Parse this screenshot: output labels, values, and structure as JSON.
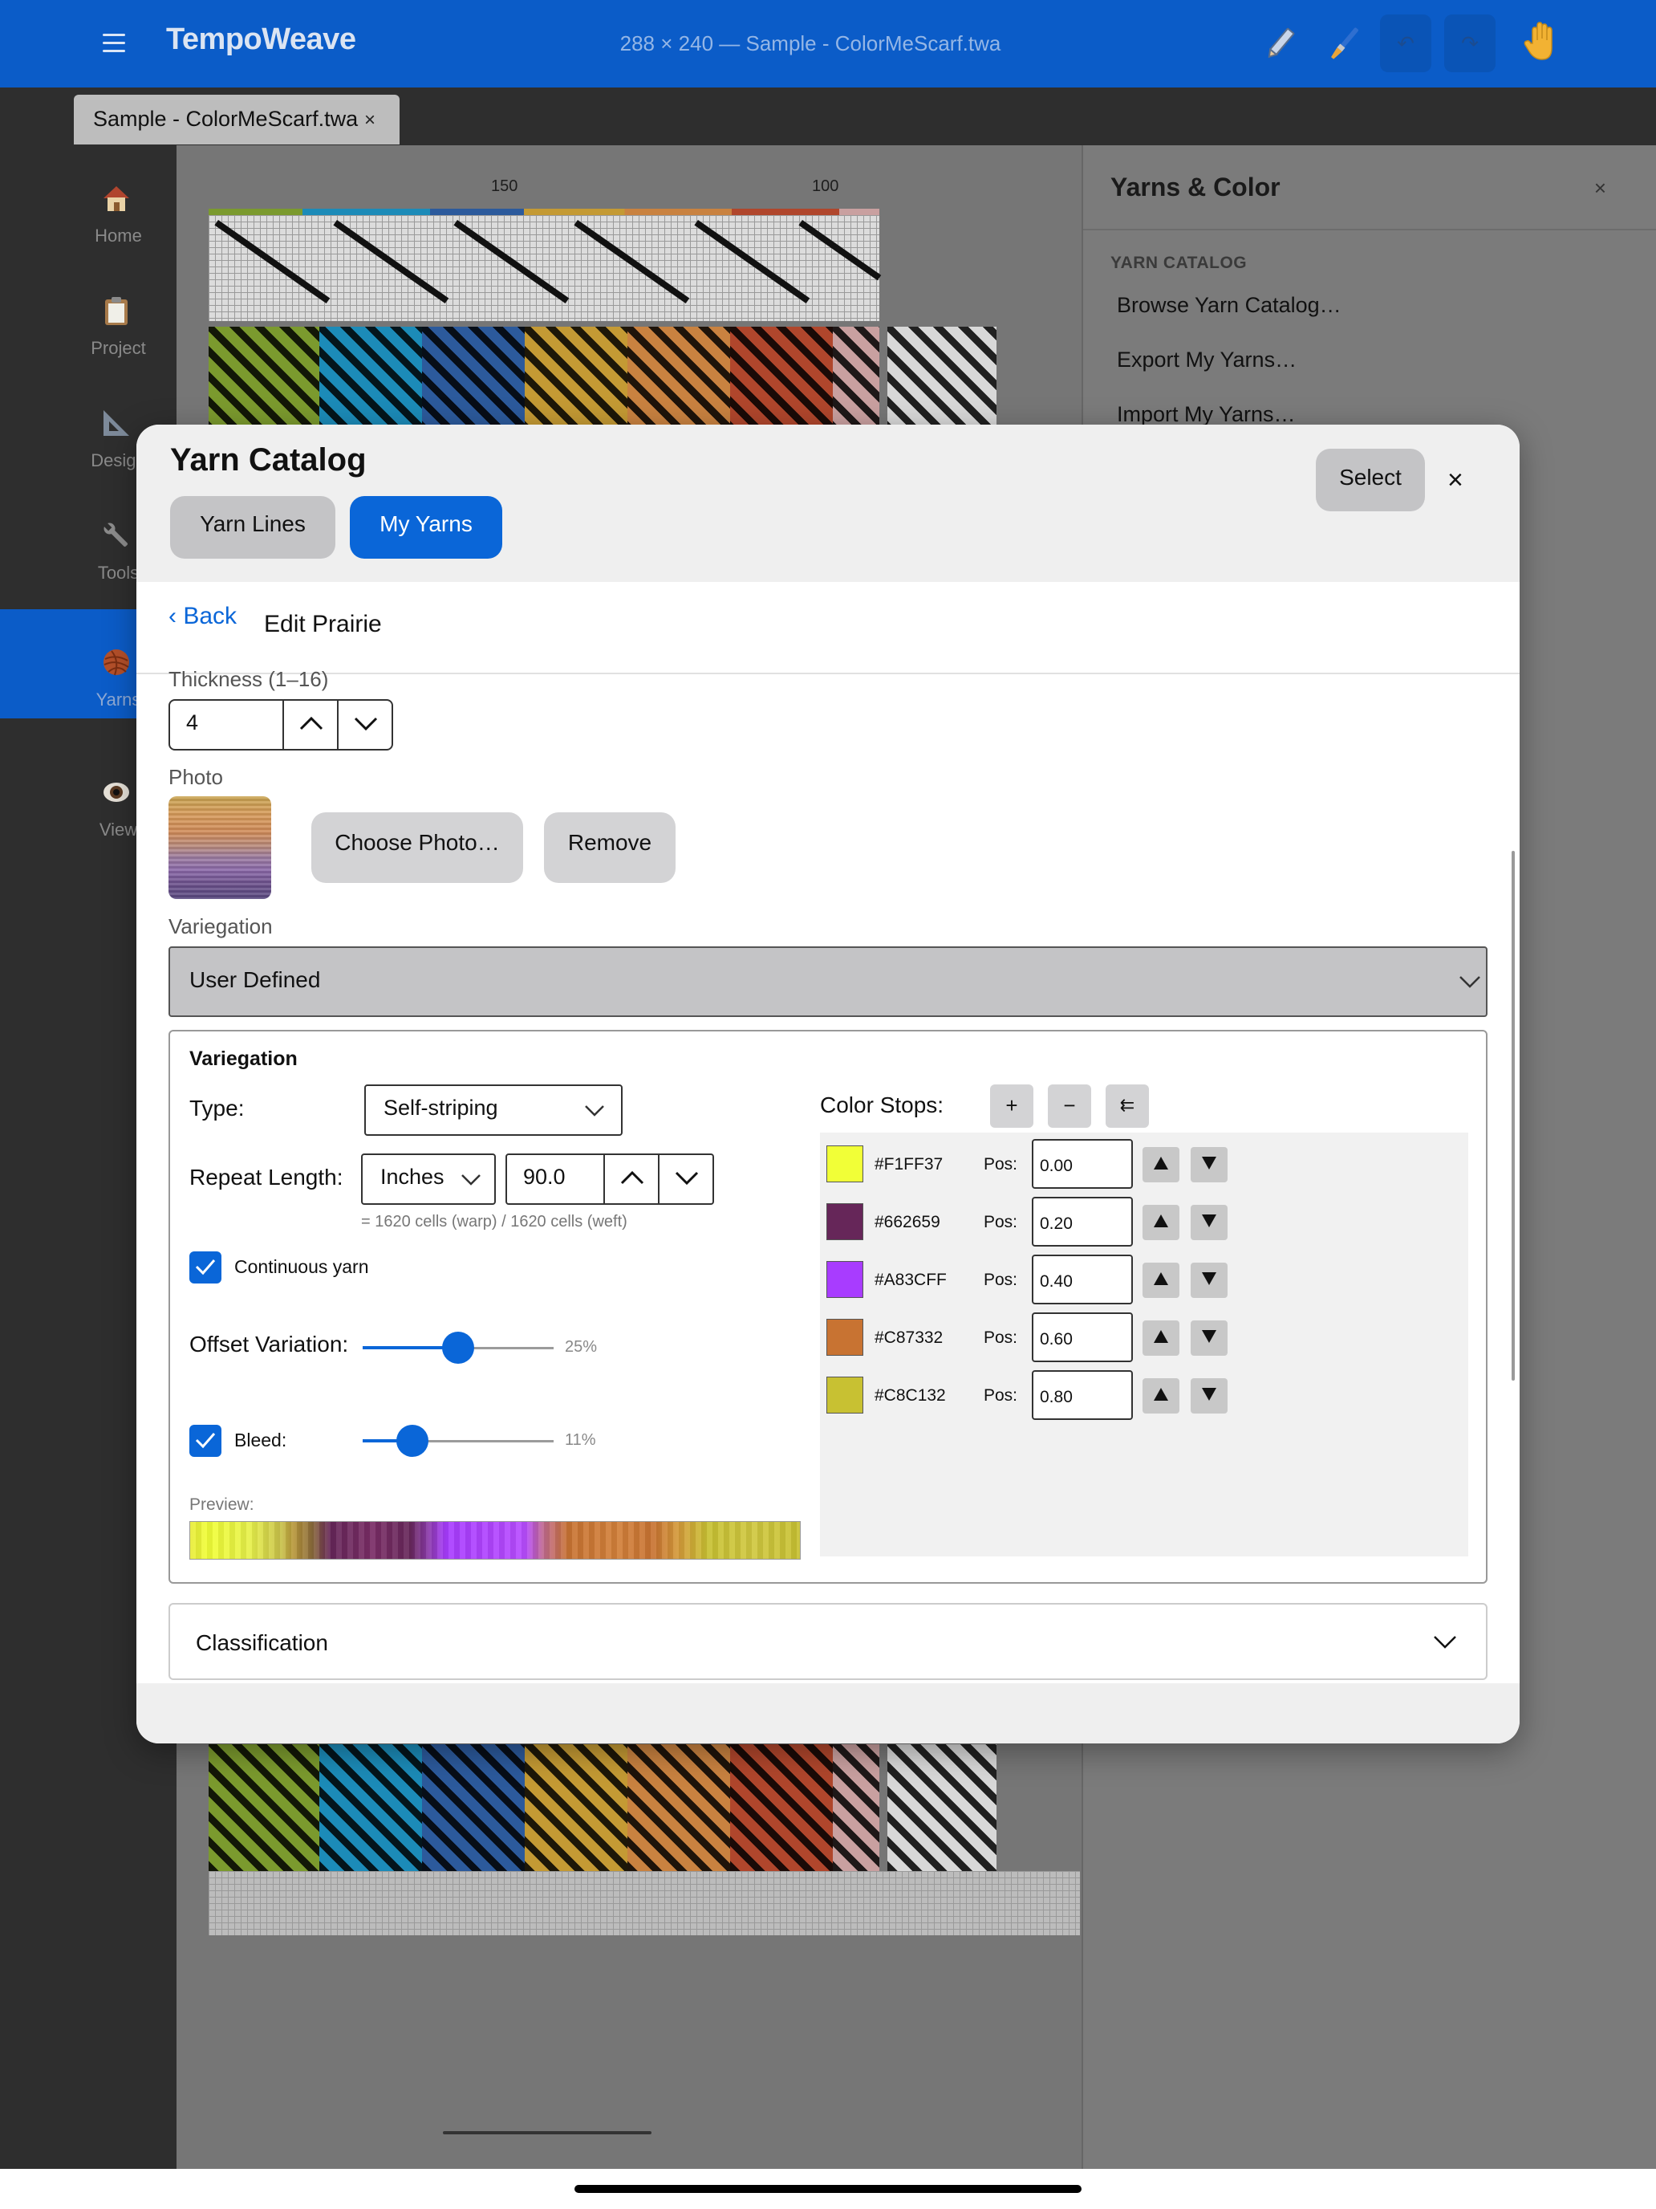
{
  "topbar": {
    "app_title": "TempoWeave",
    "document_title": "288 × 240 — Sample - ColorMeScarf.twa"
  },
  "tabs": [
    {
      "label": "Sample - ColorMeScarf.twa",
      "close": "×"
    }
  ],
  "sidebar": {
    "items": [
      {
        "label": "Home",
        "icon": "house-icon"
      },
      {
        "label": "Project",
        "icon": "clipboard-icon"
      },
      {
        "label": "Design",
        "icon": "set-square-icon"
      },
      {
        "label": "Tools",
        "icon": "wrench-icon"
      },
      {
        "label": "Yarns",
        "icon": "yarn-ball-icon",
        "active": true
      },
      {
        "label": "View",
        "icon": "eye-icon"
      }
    ]
  },
  "canvas": {
    "ruler_labels": [
      "150",
      "100"
    ]
  },
  "right_panel": {
    "title": "Yarns & Color",
    "close": "×",
    "section": "YARN CATALOG",
    "items": [
      "Browse Yarn Catalog…",
      "Export My Yarns…",
      "Import My Yarns…"
    ]
  },
  "modal": {
    "title": "Yarn Catalog",
    "segments": [
      "Yarn Lines",
      "My Yarns"
    ],
    "active_segment": "My Yarns",
    "select_label": "Select",
    "close": "×",
    "back_label": "‹ Back",
    "edit_title": "Edit Prairie",
    "thickness": {
      "label": "Thickness (1–16)",
      "value": "4"
    },
    "photo": {
      "label": "Photo",
      "choose_label": "Choose Photo…",
      "remove_label": "Remove"
    },
    "variegation": {
      "label": "Variegation",
      "selected": "User Defined",
      "panel_title": "Variegation",
      "type_label": "Type:",
      "type_value": "Self-striping",
      "repeat_label": "Repeat Length:",
      "repeat_units": "Inches",
      "repeat_value": "90.0",
      "repeat_hint": "= 1620 cells (warp) / 1620 cells (weft)",
      "continuous_label": "Continuous yarn",
      "continuous_checked": true,
      "offset_label": "Offset Variation:",
      "offset_value_text": "25%",
      "offset_value": 0.5,
      "bleed_label": "Bleed:",
      "bleed_checked": true,
      "bleed_value_text": "11%",
      "bleed_value": 0.26,
      "preview_label": "Preview:",
      "stops_label": "Color Stops:",
      "stop_tools": [
        "+",
        "−",
        "⇇"
      ],
      "stops": [
        {
          "hex": "#F1FF37",
          "pos_label": "Pos:",
          "pos": "0.00"
        },
        {
          "hex": "#662659",
          "pos_label": "Pos:",
          "pos": "0.20"
        },
        {
          "hex": "#A83CFF",
          "pos_label": "Pos:",
          "pos": "0.40"
        },
        {
          "hex": "#C87332",
          "pos_label": "Pos:",
          "pos": "0.60"
        },
        {
          "hex": "#C8C132",
          "pos_label": "Pos:",
          "pos": "0.80"
        }
      ]
    },
    "classification_label": "Classification"
  },
  "colors": {
    "accent": "#0A66D8",
    "topbar": "#0B5CC8"
  }
}
